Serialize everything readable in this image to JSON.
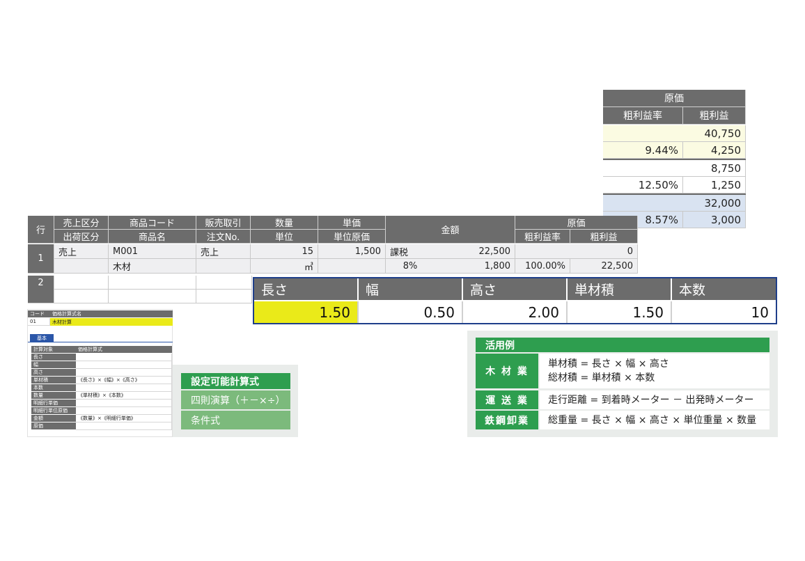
{
  "cost_panel": {
    "title": "原価",
    "col_rate": "粗利益率",
    "col_profit": "粗利益",
    "rows": [
      {
        "cost": "40,750",
        "rate": "9.44%",
        "profit": "4,250"
      },
      {
        "cost": "8,750",
        "rate": "12.50%",
        "profit": "1,250"
      },
      {
        "cost": "32,000",
        "rate": "8.57%",
        "profit": "3,000"
      }
    ]
  },
  "detail_table": {
    "headers": {
      "row": "行",
      "sales_type": "売上区分",
      "ship_type": "出荷区分",
      "product_code": "商品コード",
      "product_name": "商品名",
      "trade": "販売取引",
      "order_no": "注文No.",
      "qty": "数量",
      "unit": "単位",
      "unit_price": "単価",
      "unit_cost": "単位原価",
      "amount": "金額",
      "cost": "原価",
      "gross_rate": "粗利益率",
      "gross_profit": "粗利益"
    },
    "row1": {
      "no": "1",
      "sales_type": "売上",
      "product_code": "M001",
      "product_name": "木材",
      "trade": "売上",
      "qty": "15",
      "unit": "㎥",
      "unit_price": "1,500",
      "tax_type": "課税",
      "tax_rate": "8%",
      "amount": "22,500",
      "tax_amount": "1,800",
      "cost": "0",
      "gross_rate": "100.00%",
      "gross_profit": "22,500"
    },
    "row2": {
      "no": "2"
    }
  },
  "dimension_panel": {
    "headers": [
      "長さ",
      "幅",
      "高さ",
      "単材積",
      "本数"
    ],
    "values": [
      "1.50",
      "0.50",
      "2.00",
      "1.50",
      "10"
    ]
  },
  "formula_screen": {
    "code_label": "コード",
    "name_label": "価格計算式名",
    "code": "01",
    "name": "木材計算",
    "tab": "基本",
    "col_target": "計算対象",
    "col_formula": "価格計算式",
    "rows": [
      {
        "target": "長さ",
        "formula": ""
      },
      {
        "target": "幅",
        "formula": ""
      },
      {
        "target": "高さ",
        "formula": ""
      },
      {
        "target": "単材積",
        "formula": "《長さ》×《幅》×《高さ》"
      },
      {
        "target": "本数",
        "formula": ""
      },
      {
        "target": "数量",
        "formula": "《単材積》×《本数》"
      },
      {
        "target": "明細行単価",
        "formula": ""
      },
      {
        "target": "明細行単位原価",
        "formula": ""
      },
      {
        "target": "金額",
        "formula": "《数量》×《明細行単価》"
      },
      {
        "target": "原価",
        "formula": ""
      }
    ]
  },
  "formula_types": {
    "title": "設定可能計算式",
    "items": [
      "四則演算（＋－×÷）",
      "条件式"
    ]
  },
  "use_cases": {
    "title": "活用例",
    "items": [
      {
        "label": "木 材 業",
        "lines": [
          "単材積 = 長さ × 幅 × 高さ",
          "総材積 = 単材積 × 本数"
        ]
      },
      {
        "label": "運 送 業",
        "lines": [
          "走行距離 = 到着時メーター － 出発時メーター"
        ]
      },
      {
        "label": "鉄鋼卸業",
        "lines": [
          "総重量 = 長さ × 幅 × 高さ × 単位重量 × 数量"
        ]
      }
    ]
  },
  "colors": {
    "header_gray": "#6c6c6c",
    "green_dark": "#2e9e4f",
    "green_light": "#7cba7c",
    "panel_border_blue": "#1f3f8a",
    "highlight_yellow": "#eaea19"
  }
}
